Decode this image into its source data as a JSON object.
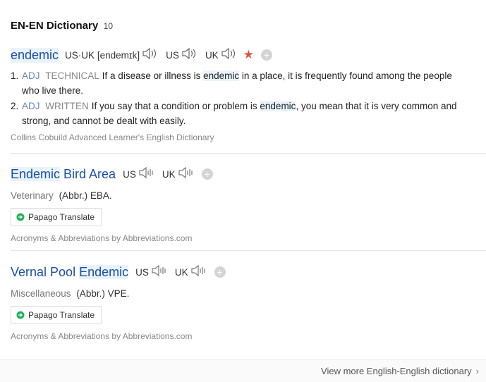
{
  "header": {
    "title": "EN-EN Dictionary",
    "count": "10"
  },
  "entries": [
    {
      "word": "endemic",
      "pron_label": "US·UK",
      "ipa": "[endemɪk]",
      "us": "US",
      "uk": "UK",
      "defs": [
        {
          "num": "1.",
          "pos": "ADJ",
          "reg": "TECHNICAL",
          "pre": "If a disease or illness is ",
          "kw": "endemic",
          "post": " in a place, it is frequently found among the people who live there."
        },
        {
          "num": "2.",
          "pos": "ADJ",
          "reg": "WRITTEN",
          "pre": "If you say that a condition or problem is ",
          "kw": "endemic",
          "post": ", you mean that it is very common and strong, and cannot be dealt with easily."
        }
      ],
      "source": "Collins Cobuild Advanced Learner's English Dictionary"
    },
    {
      "word_hl": "Endemic",
      "word_rest": " Bird Area",
      "us": "US",
      "uk": "UK",
      "field": "Veterinary",
      "abbr": "(Abbr.) EBA.",
      "papago": "Papago Translate",
      "source": "Acronyms & Abbreviations by Abbreviations.com"
    },
    {
      "word_pre": "Vernal Pool ",
      "word_hl": "Endemic",
      "us": "US",
      "uk": "UK",
      "field": "Miscellaneous",
      "abbr": "(Abbr.) VPE.",
      "papago": "Papago Translate",
      "source": "Acronyms & Abbreviations by Abbreviations.com"
    }
  ],
  "footer": {
    "more": "View more English-English dictionary"
  },
  "icons": [
    "speaker-icon",
    "speaker-bars-icon",
    "star-icon",
    "plus-icon",
    "papago-icon",
    "chevron-right-icon"
  ],
  "colors": {
    "link": "#1a4fa6",
    "highlight": "#e9f3fb",
    "star": "#e0533b"
  }
}
